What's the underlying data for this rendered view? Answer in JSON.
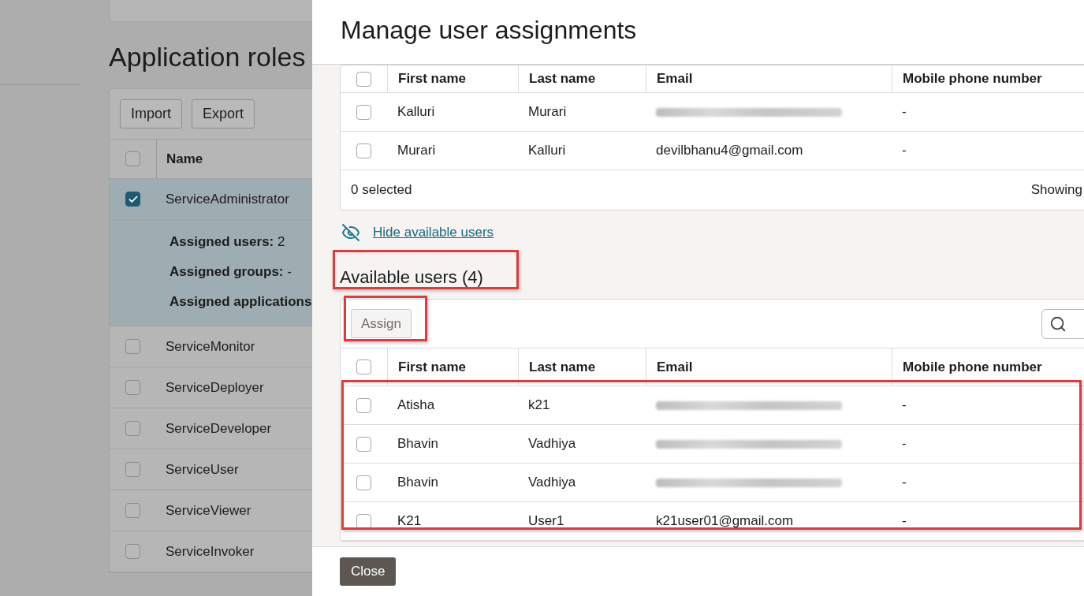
{
  "background_page": {
    "title": "Application roles",
    "toolbar_buttons": [
      "Import",
      "Export"
    ],
    "table": {
      "columns": [
        "Name"
      ],
      "header_checked": false,
      "rows": [
        {
          "name": "ServiceAdministrator",
          "checked": true,
          "expanded": true,
          "details": [
            "**Assigned users:** 2",
            "**Assigned groups:** -",
            "**Assigned applications**"
          ]
        },
        {
          "name": "ServiceMonitor",
          "checked": false,
          "expanded": false
        },
        {
          "name": "ServiceDeployer",
          "checked": false,
          "expanded": false
        },
        {
          "name": "ServiceDeveloper",
          "checked": false,
          "expanded": false
        },
        {
          "name": "ServiceUser",
          "checked": false,
          "expanded": false
        },
        {
          "name": "ServiceViewer",
          "checked": false,
          "expanded": false
        },
        {
          "name": "ServiceInvoker",
          "checked": false,
          "expanded": false
        }
      ]
    }
  },
  "drawer": {
    "title": "Manage user assignments",
    "assigned_table": {
      "columns": [
        "First name",
        "Last name",
        "Email",
        "Mobile phone number"
      ],
      "header_checked": false,
      "rows": [
        {
          "first_name": "Kalluri",
          "last_name": "Murari",
          "email_blurred": true,
          "mobile": "-",
          "checked": false
        },
        {
          "first_name": "Murari",
          "last_name": "Kalluri",
          "email": "devilbhanu4@gmail.com",
          "email_blurred": false,
          "mobile": "-",
          "checked": false
        }
      ],
      "selected_count": "0 selected",
      "showing": "Showing"
    },
    "toggle_link": "Hide available users",
    "available": {
      "heading": "Available users (4)",
      "assign_button": {
        "label": "Assign",
        "disabled": true
      },
      "table": {
        "columns": [
          "First name",
          "Last name",
          "Email",
          "Mobile phone number"
        ],
        "header_checked": false,
        "rows": [
          {
            "first_name": "Atisha",
            "last_name": "k21",
            "email_blurred": true,
            "mobile": "-",
            "checked": false
          },
          {
            "first_name": "Bhavin",
            "last_name": "Vadhiya",
            "email_blurred": true,
            "mobile": "-",
            "checked": false
          },
          {
            "first_name": "Bhavin",
            "last_name": "Vadhiya",
            "email_blurred": true,
            "mobile": "-",
            "checked": false
          },
          {
            "first_name": "K21",
            "last_name": "User1",
            "email": "k21user01@gmail.com",
            "email_blurred": false,
            "mobile": "-",
            "checked": false
          }
        ]
      }
    },
    "footer_buttons": [
      "Close"
    ]
  }
}
